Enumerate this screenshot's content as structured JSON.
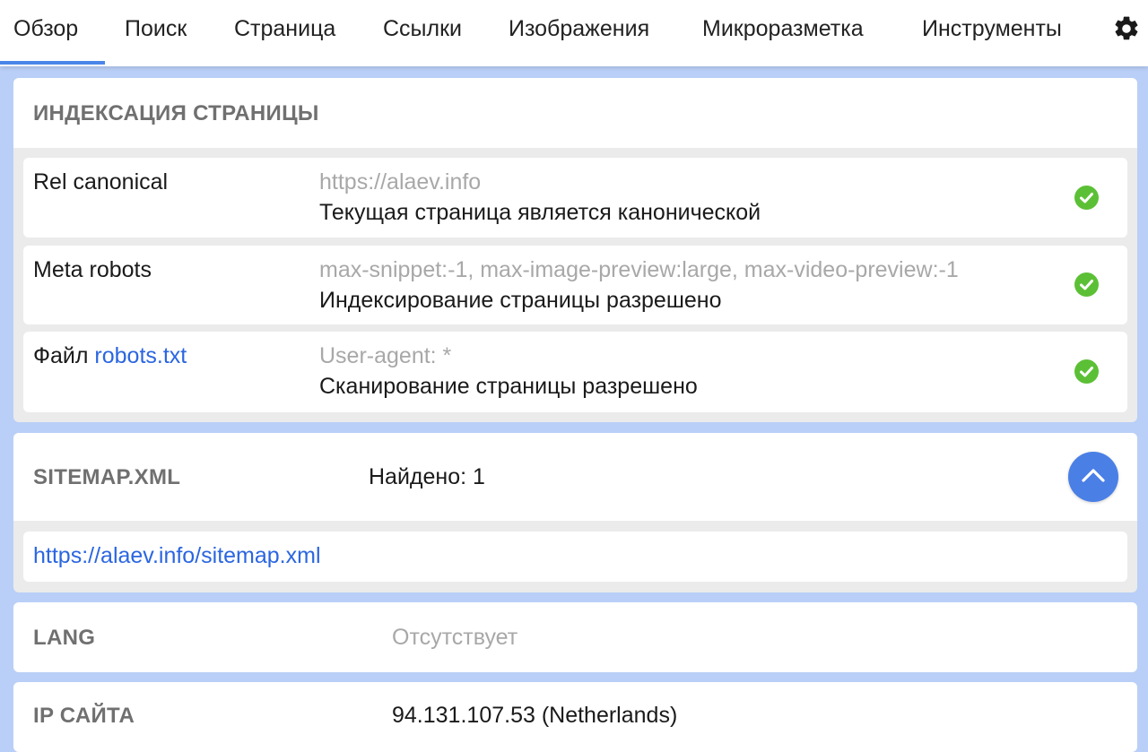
{
  "nav": {
    "tabs": [
      "Обзор",
      "Поиск",
      "Страница",
      "Ссылки",
      "Изображения",
      "Микроразметка",
      "Инструменты"
    ],
    "active_tab": "Обзор",
    "settings_icon": "gear-icon"
  },
  "indexing": {
    "title": "ИНДЕКСАЦИЯ СТРАНИЦЫ",
    "rows": [
      {
        "label": "Rel canonical",
        "detail": "https://alaev.info",
        "status": "Текущая страница является канонической",
        "icon": "check-circle-icon"
      },
      {
        "label": "Meta robots",
        "detail": "max-snippet:-1, max-image-preview:large, max-video-preview:-1",
        "status": "Индексирование страницы разрешено",
        "icon": "check-circle-icon"
      },
      {
        "label_prefix": "Файл",
        "label_link": "robots.txt",
        "detail": "User-agent: *",
        "status": "Сканирование страницы разрешено",
        "icon": "check-circle-icon"
      }
    ]
  },
  "sitemap": {
    "title": "SITEMAP.XML",
    "found": "Найдено: 1",
    "link": "https://alaev.info/sitemap.xml",
    "collapse_icon": "chevron-up-icon"
  },
  "lang": {
    "title": "LANG",
    "value": "Отсутствует"
  },
  "ip": {
    "title": "IP САЙТА",
    "value": "94.131.107.53 (Netherlands)"
  },
  "colors": {
    "accent": "#4a86e8",
    "link": "#2b66e0",
    "check": "#5cc036",
    "page_bg": "#b9cff7"
  }
}
